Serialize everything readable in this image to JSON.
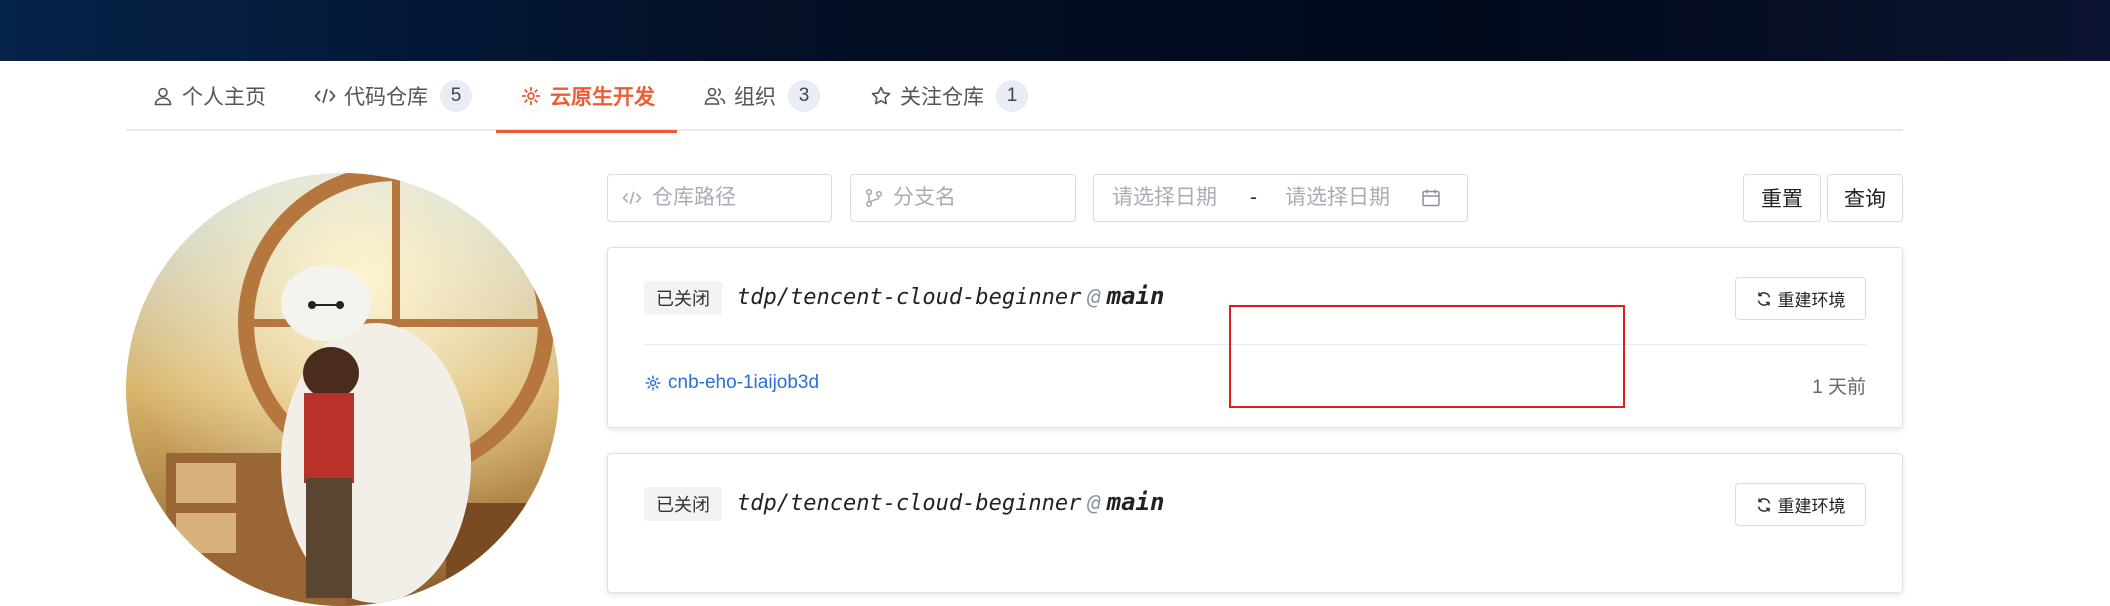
{
  "tabs": [
    {
      "label": "个人主页",
      "icon": "user-icon"
    },
    {
      "label": "代码仓库",
      "icon": "code-icon",
      "count": "5"
    },
    {
      "label": "云原生开发",
      "icon": "cloud-dev-icon",
      "active": true
    },
    {
      "label": "组织",
      "icon": "group-icon",
      "count": "3"
    },
    {
      "label": "关注仓库",
      "icon": "star-icon",
      "count": "1"
    }
  ],
  "filters": {
    "repo_path_placeholder": "仓库路径",
    "branch_placeholder": "分支名",
    "date_start_placeholder": "请选择日期",
    "date_separator": "-",
    "date_end_placeholder": "请选择日期",
    "reset_label": "重置",
    "query_label": "查询"
  },
  "cards": [
    {
      "status": "已关闭",
      "repo": "tdp/tencent-cloud-beginner",
      "at": "@",
      "branch": "main",
      "rebuild_label": "重建环境",
      "env_name": "cnb-eho-1iaijob3d",
      "time": "1 天前"
    },
    {
      "status": "已关闭",
      "repo": "tdp/tencent-cloud-beginner",
      "at": "@",
      "branch": "main",
      "rebuild_label": "重建环境"
    }
  ],
  "colors": {
    "accent": "#ee5b33",
    "link": "#2c6fd6",
    "highlight": "#e01e1e",
    "topbar": "#031027"
  }
}
